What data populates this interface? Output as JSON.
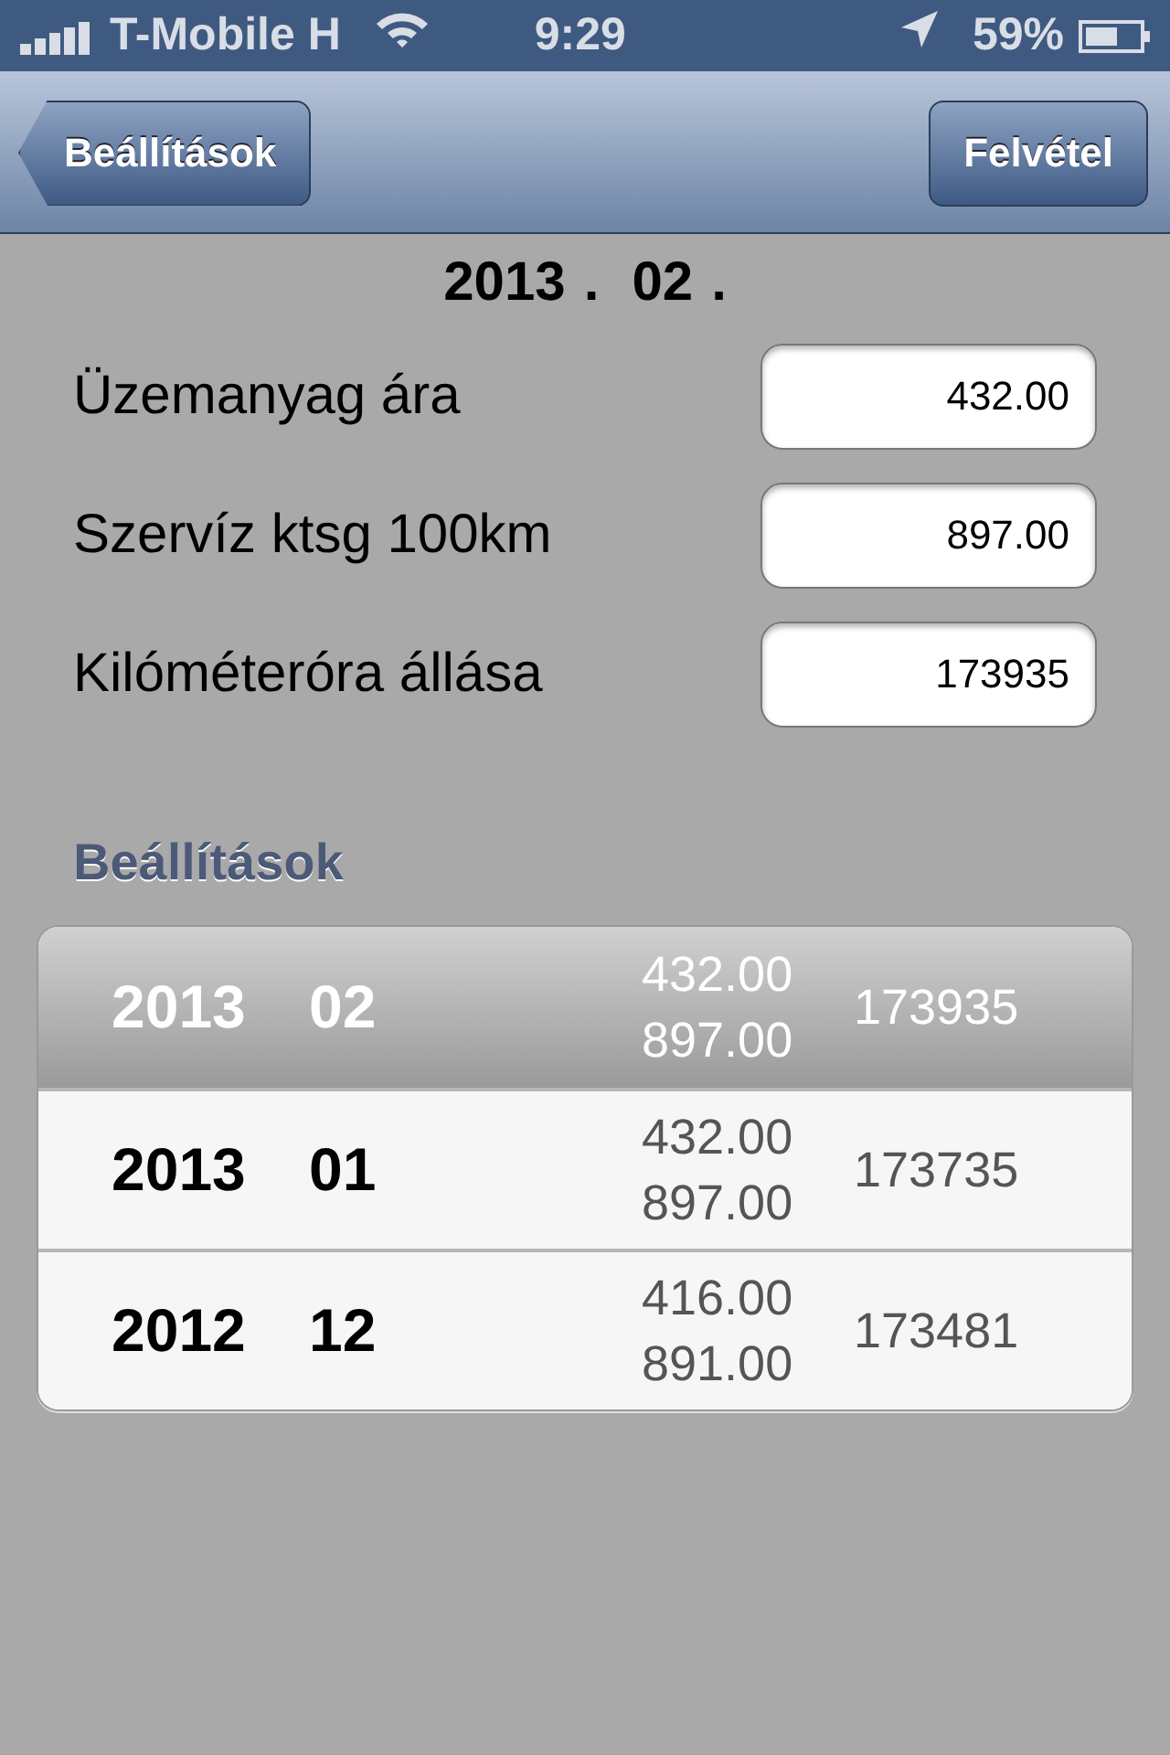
{
  "status_bar": {
    "carrier": "T-Mobile H",
    "time": "9:29",
    "battery": "59%"
  },
  "nav_bar": {
    "back_button": "Beállítások",
    "right_button": "Felvétel"
  },
  "period": {
    "year": "2013",
    "year_dot": ".",
    "month": "02",
    "month_dot": "."
  },
  "fields": [
    {
      "label": "Üzemanyag ára",
      "value": "432.00"
    },
    {
      "label": "Szervíz ktsg 100km",
      "value": "897.00"
    },
    {
      "label": "Kilóméteróra állása",
      "value": "173935"
    }
  ],
  "section_title": "Beállítások",
  "rows": [
    {
      "year": "2013",
      "month": "02",
      "price": "432.00",
      "service": "897.00",
      "odometer": "173935",
      "selected": true
    },
    {
      "year": "2013",
      "month": "01",
      "price": "432.00",
      "service": "897.00",
      "odometer": "173735",
      "selected": false
    },
    {
      "year": "2012",
      "month": "12",
      "price": "416.00",
      "service": "891.00",
      "odometer": "173481",
      "selected": false
    }
  ]
}
